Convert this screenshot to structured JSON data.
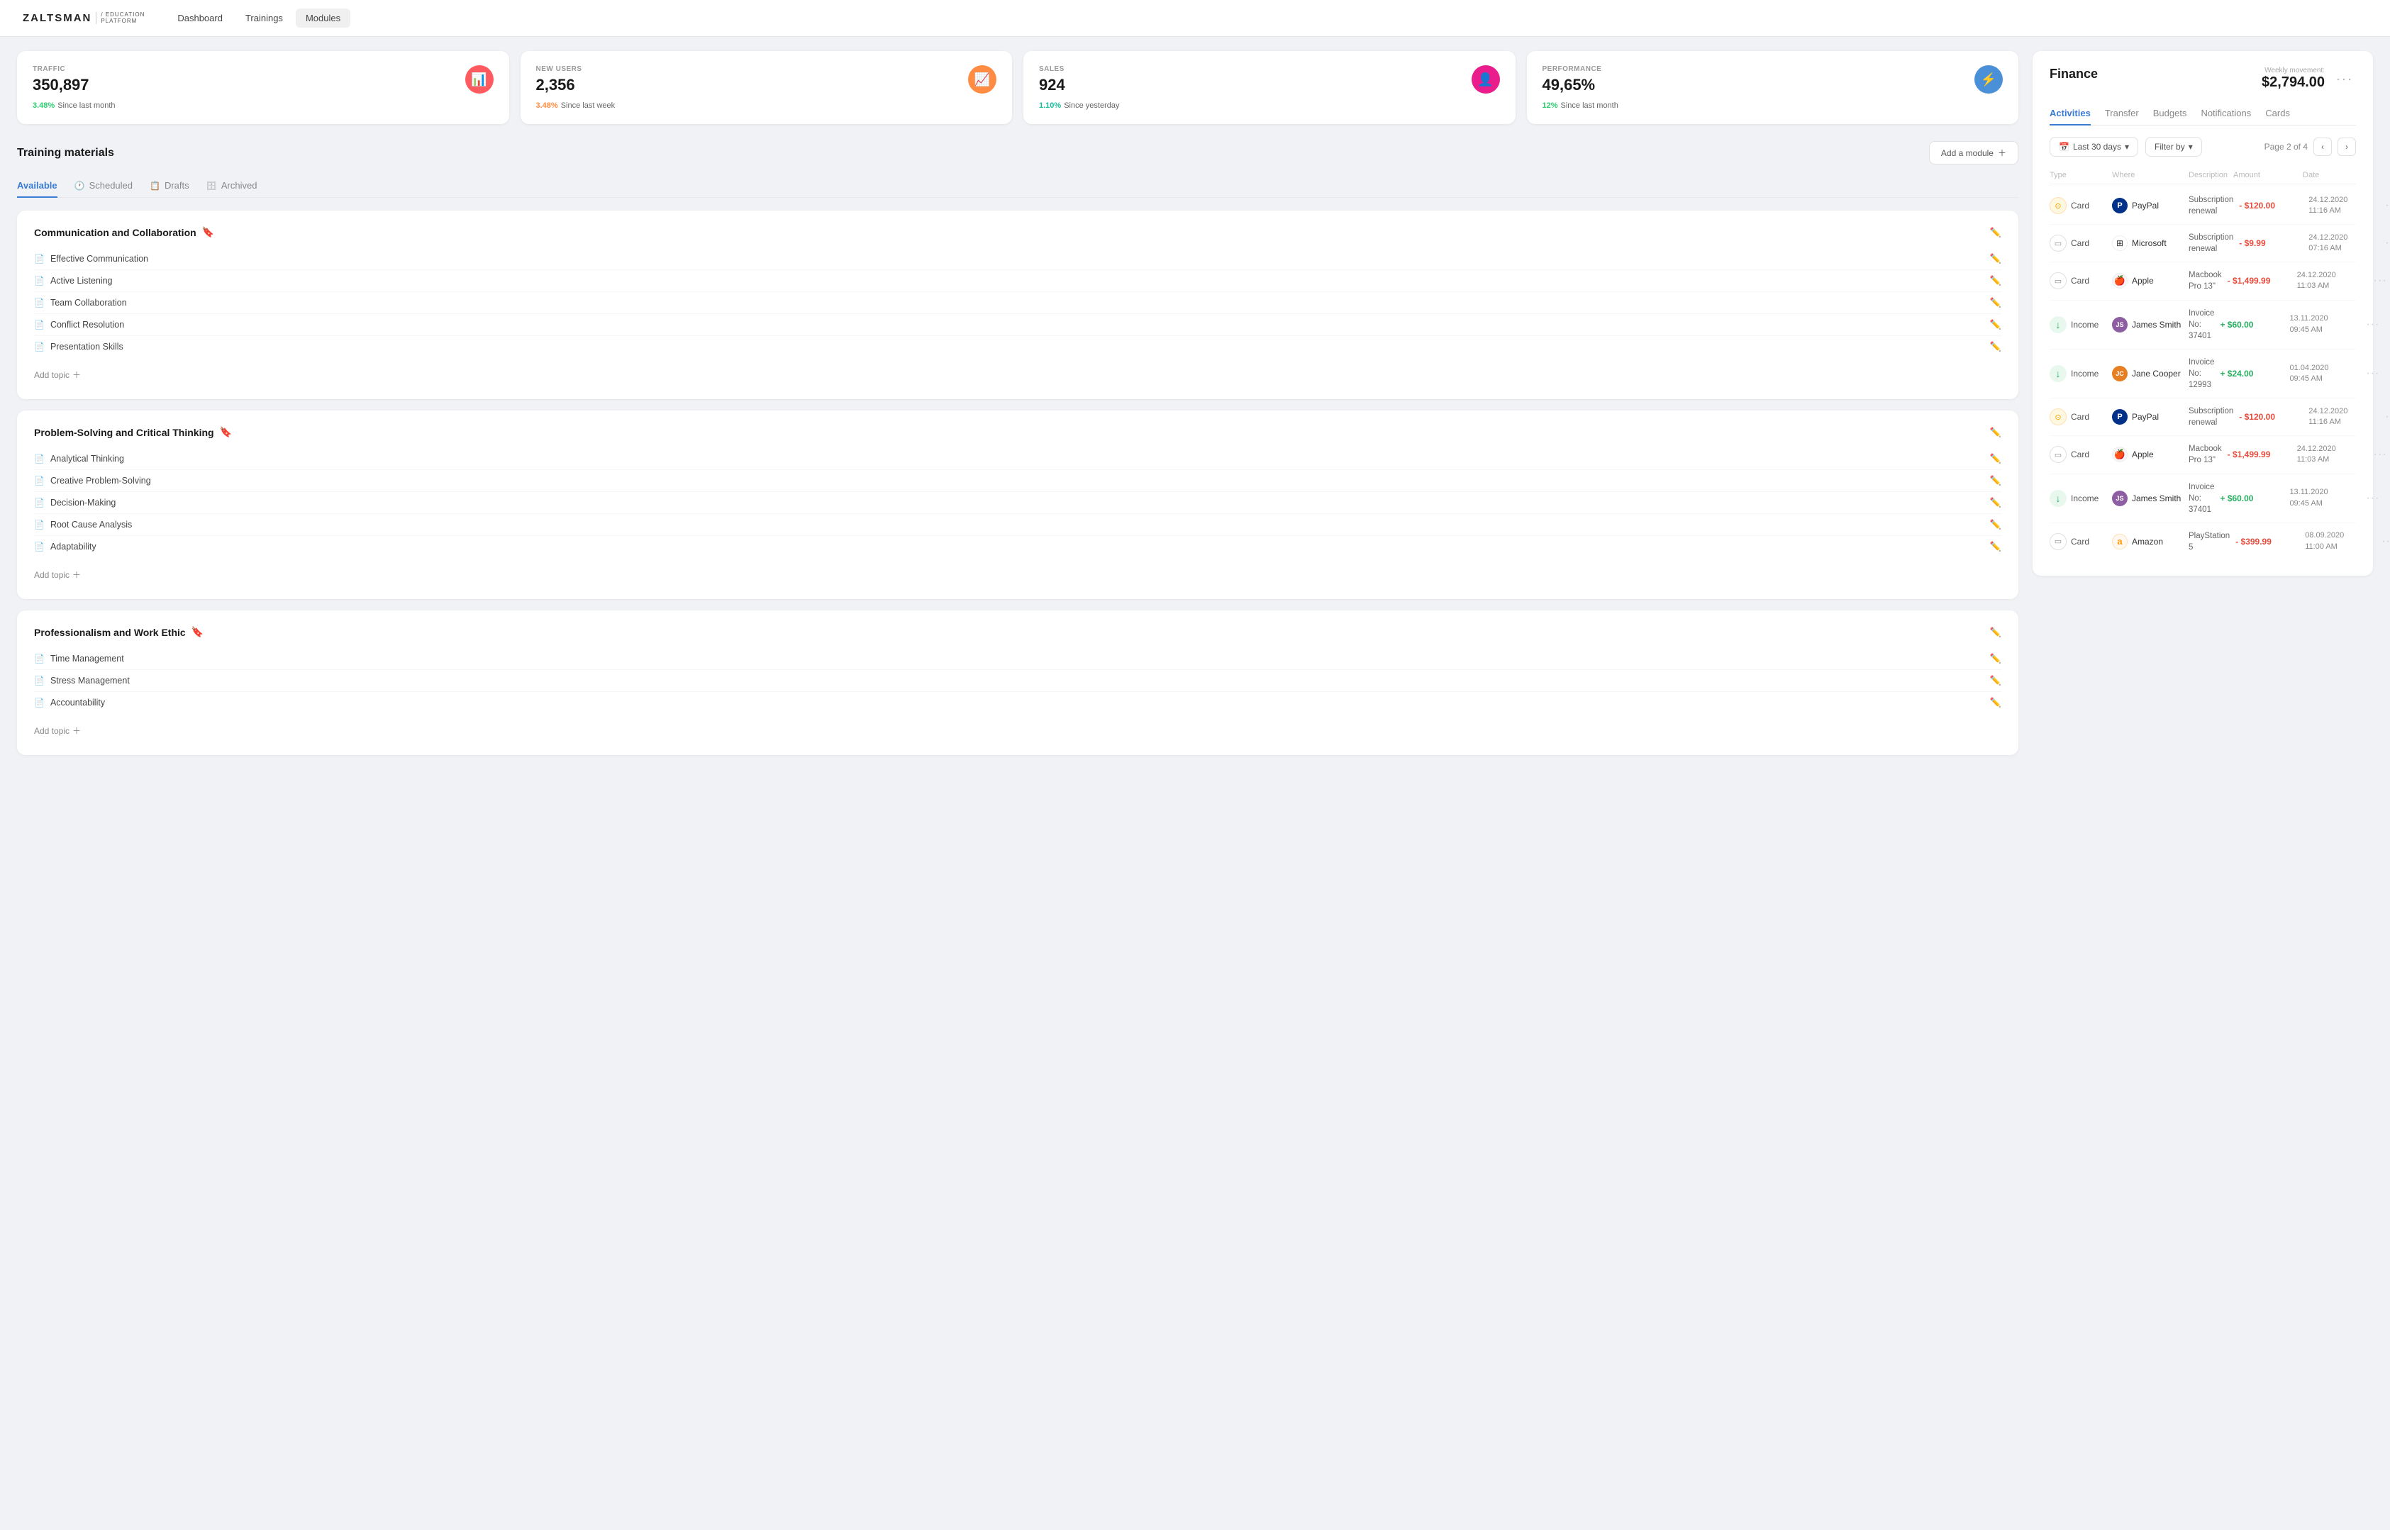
{
  "brand": {
    "name": "ZALTSMAN",
    "sub_line1": "/ EDUCATION",
    "sub_line2": "PLATFORM"
  },
  "nav": {
    "links": [
      "Dashboard",
      "Trainings",
      "Modules"
    ]
  },
  "stats": [
    {
      "label": "TRAFFIC",
      "value": "350,897",
      "icon": "📊",
      "icon_color": "red",
      "change_pct": "3.48%",
      "change_pct_color": "green",
      "change_label": "Since last month",
      "change_direction": "▲"
    },
    {
      "label": "NEW USERS",
      "value": "2,356",
      "icon": "📈",
      "icon_color": "orange",
      "change_pct": "3.48%",
      "change_pct_color": "orange",
      "change_label": "Since last week",
      "change_direction": "▲"
    },
    {
      "label": "SALES",
      "value": "924",
      "icon": "👤",
      "icon_color": "pink",
      "change_pct": "1.10%",
      "change_pct_color": "teal",
      "change_label": "Since yesterday",
      "change_direction": "▲"
    },
    {
      "label": "PERFORMANCE",
      "value": "49,65%",
      "icon": "⚡",
      "icon_color": "blue",
      "change_pct": "12%",
      "change_pct_color": "green",
      "change_label": "Since last month",
      "change_direction": "▲"
    }
  ],
  "training": {
    "title": "Training materials",
    "add_button": "Add a module",
    "tabs": [
      "Available",
      "Scheduled",
      "Drafts",
      "Archived"
    ],
    "active_tab": "Available",
    "modules": [
      {
        "title": "Communication and Collaboration",
        "topics": [
          "Effective Communication",
          "Active Listening",
          "Team Collaboration",
          "Conflict Resolution",
          "Presentation Skills"
        ],
        "add_topic_label": "Add topic"
      },
      {
        "title": "Problem-Solving and Critical Thinking",
        "topics": [
          "Analytical Thinking",
          "Creative Problem-Solving",
          "Decision-Making",
          "Root Cause Analysis",
          "Adaptability"
        ],
        "add_topic_label": "Add topic"
      },
      {
        "title": "Professionalism and Work Ethic",
        "topics": [
          "Time Management",
          "Stress Management",
          "Accountability"
        ],
        "add_topic_label": "Add topic"
      }
    ]
  },
  "finance": {
    "title": "Finance",
    "weekly_label": "Weekly movement:",
    "weekly_value": "$2,794.00",
    "tabs": [
      "Activities",
      "Transfer",
      "Budgets",
      "Notifications",
      "Cards"
    ],
    "active_tab": "Activities",
    "filter": {
      "date_range": "Last 30 days",
      "filter_by": "Filter by",
      "page_info": "Page 2 of 4"
    },
    "columns": [
      "Type",
      "Where",
      "Description",
      "Amount",
      "Date"
    ],
    "transactions": [
      {
        "type": "Card",
        "type_icon": "⊙",
        "where": "PayPal",
        "where_icon": "🅿",
        "where_color": "#003087",
        "description": "Subscription renewal",
        "amount": "- $120.00",
        "amount_class": "negative",
        "date": "24.12.2020",
        "time": "11:16 AM"
      },
      {
        "type": "Card",
        "type_icon": "▭",
        "where": "Microsoft",
        "where_icon": "⊞",
        "where_color": "#f25022",
        "description": "Subscription renewal",
        "amount": "- $9.99",
        "amount_class": "negative",
        "date": "24.12.2020",
        "time": "07:16 AM"
      },
      {
        "type": "Card",
        "type_icon": "▭",
        "where": "Apple",
        "where_icon": "",
        "where_color": "#555",
        "description": "Macbook Pro 13\"",
        "amount": "- $1,499.99",
        "amount_class": "red-bold",
        "date": "24.12.2020",
        "time": "11:03 AM"
      },
      {
        "type": "Income",
        "type_icon": "↓",
        "where": "James Smith",
        "where_icon": "JS",
        "where_color": "#8e5ea2",
        "description": "Invoice No: 37401",
        "amount": "+ $60.00",
        "amount_class": "positive",
        "date": "13.11.2020",
        "time": "09:45 AM"
      },
      {
        "type": "Income",
        "type_icon": "↓",
        "where": "Jane Cooper",
        "where_icon": "JC",
        "where_color": "#e67e22",
        "description": "Invoice No: 12993",
        "amount": "+ $24.00",
        "amount_class": "positive",
        "date": "01.04.2020",
        "time": "09:45 AM"
      },
      {
        "type": "Card",
        "type_icon": "⊙",
        "where": "PayPal",
        "where_icon": "🅿",
        "where_color": "#003087",
        "description": "Subscription renewal",
        "amount": "- $120.00",
        "amount_class": "negative",
        "date": "24.12.2020",
        "time": "11:16 AM"
      },
      {
        "type": "Card",
        "type_icon": "▭",
        "where": "Apple",
        "where_icon": "",
        "where_color": "#555",
        "description": "Macbook Pro 13\"",
        "amount": "- $1,499.99",
        "amount_class": "red-bold",
        "date": "24.12.2020",
        "time": "11:03 AM"
      },
      {
        "type": "Income",
        "type_icon": "↓",
        "where": "James Smith",
        "where_icon": "JS",
        "where_color": "#8e5ea2",
        "description": "Invoice No: 37401",
        "amount": "+ $60.00",
        "amount_class": "positive",
        "date": "13.11.2020",
        "time": "09:45 AM"
      },
      {
        "type": "Card",
        "type_icon": "▭",
        "where": "Amazon",
        "where_icon": "a",
        "where_color": "#ff9900",
        "description": "PlayStation 5",
        "amount": "- $399.99",
        "amount_class": "negative",
        "date": "08.09.2020",
        "time": "11:00 AM"
      }
    ]
  }
}
